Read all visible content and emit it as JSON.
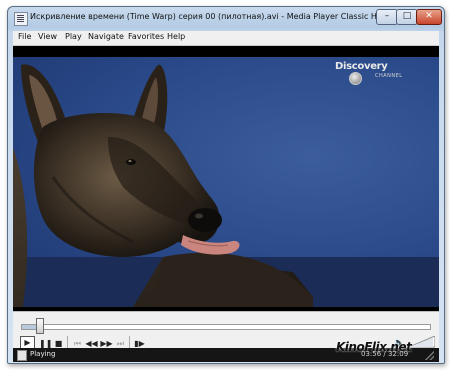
{
  "window": {
    "title": "Искривление времени (Time Warp) серия 00 (пилотная).avi - Media Player Classic Home Cinema - v",
    "controls": {
      "minimize": "–",
      "maximize": "□",
      "close": "✕"
    }
  },
  "menu": {
    "items": [
      {
        "label": "File"
      },
      {
        "label": "View"
      },
      {
        "label": "Play"
      },
      {
        "label": "Navigate"
      },
      {
        "label": "Favorites"
      },
      {
        "label": "Help"
      }
    ]
  },
  "video": {
    "logo_text": "Discovery",
    "logo_sub": "CHANNEL"
  },
  "playback": {
    "progress": 0.045,
    "buttons": {
      "play": "▶",
      "pause": "❚❚",
      "stop": "■",
      "prev": "⏮",
      "rewind": "◀◀",
      "forward": "▶▶",
      "next": "⏭",
      "frame_step": "▮▶"
    },
    "volume_icon": "speaker-icon"
  },
  "status": {
    "text": "Playing",
    "time": "03:56 / 32:09"
  },
  "watermark": "KinoFlix.net",
  "colors": {
    "video_background": "#2c4c8c",
    "status_bar": "#151515",
    "title_bar": "#c4d7ec"
  }
}
